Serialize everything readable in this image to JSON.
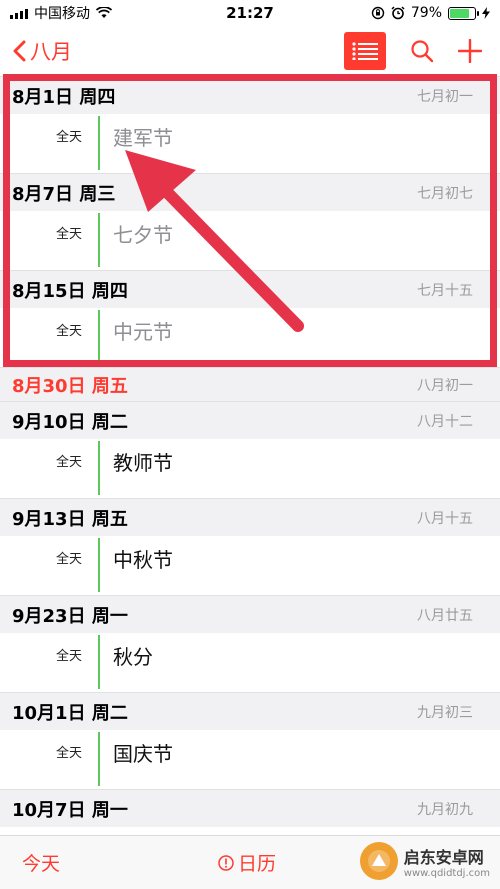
{
  "status_bar": {
    "carrier": "中国移动",
    "time": "21:27",
    "battery_percent": "79%",
    "battery_level": 0.79,
    "icons": [
      "signal-icon",
      "wifi-icon",
      "rotation-lock-icon",
      "alarm-icon",
      "battery-icon",
      "charging-icon"
    ]
  },
  "nav": {
    "back_label": "八月",
    "accent_color": "#ff3b30"
  },
  "days": [
    {
      "date": "8月1日 周四",
      "lunar": "七月初一",
      "today": false,
      "events": [
        {
          "allday": "全天",
          "title": "建军节",
          "past": true
        }
      ]
    },
    {
      "date": "8月7日 周三",
      "lunar": "七月初七",
      "today": false,
      "events": [
        {
          "allday": "全天",
          "title": "七夕节",
          "past": true
        }
      ]
    },
    {
      "date": "8月15日 周四",
      "lunar": "七月十五",
      "today": false,
      "events": [
        {
          "allday": "全天",
          "title": "中元节",
          "past": true
        }
      ]
    },
    {
      "date": "8月30日 周五",
      "lunar": "八月初一",
      "today": true,
      "events": []
    },
    {
      "date": "9月10日 周二",
      "lunar": "八月十二",
      "today": false,
      "events": [
        {
          "allday": "全天",
          "title": "教师节",
          "past": false
        }
      ]
    },
    {
      "date": "9月13日 周五",
      "lunar": "八月十五",
      "today": false,
      "events": [
        {
          "allday": "全天",
          "title": "中秋节",
          "past": false
        }
      ]
    },
    {
      "date": "9月23日 周一",
      "lunar": "八月廿五",
      "today": false,
      "events": [
        {
          "allday": "全天",
          "title": "秋分",
          "past": false
        }
      ]
    },
    {
      "date": "10月1日 周二",
      "lunar": "九月初三",
      "today": false,
      "events": [
        {
          "allday": "全天",
          "title": "国庆节",
          "past": false
        }
      ]
    },
    {
      "date": "10月7日 周一",
      "lunar": "九月初九",
      "today": false,
      "events": []
    }
  ],
  "tab_bar": {
    "today_label": "今天",
    "calendar_label": "日历"
  },
  "watermark": {
    "title": "启东安卓网",
    "url": "www.qdidtdj.com"
  },
  "colors": {
    "accent": "#ff3b30",
    "event_bar": "#5ac85a",
    "highlight": "#e5344a"
  }
}
